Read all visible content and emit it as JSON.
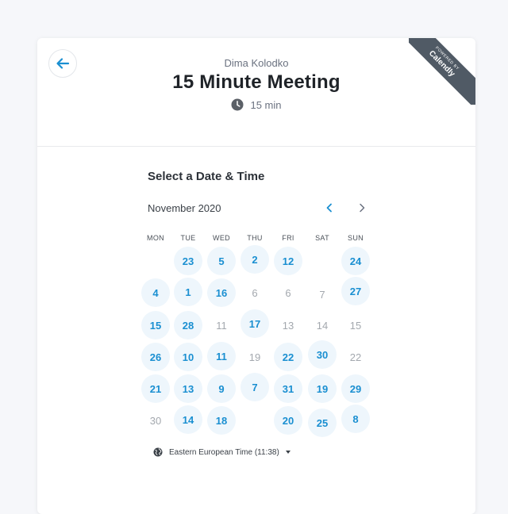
{
  "host": "Dima Kolodko",
  "title": "15 Minute Meeting",
  "duration": "15 min",
  "badge": {
    "small": "Powered by",
    "brand": "Calendly"
  },
  "section_title": "Select a Date & Time",
  "month": "November 2020",
  "weekdays": [
    "MON",
    "TUE",
    "WED",
    "THU",
    "FRI",
    "SAT",
    "SUN"
  ],
  "calendar": {
    "rows": [
      [
        null,
        {
          "label": "23",
          "available": true
        },
        {
          "label": "5",
          "available": true
        },
        {
          "label": "2",
          "available": true
        },
        {
          "label": "12",
          "available": true
        },
        null,
        {
          "label": "24",
          "available": true
        }
      ],
      [
        {
          "label": "4",
          "available": true
        },
        {
          "label": "1",
          "available": true
        },
        {
          "label": "16",
          "available": true
        },
        {
          "label": "6",
          "available": false
        },
        {
          "label": "6",
          "available": false
        },
        {
          "label": "7",
          "available": false
        },
        {
          "label": "27",
          "available": true
        }
      ],
      [
        {
          "label": "15",
          "available": true
        },
        {
          "label": "28",
          "available": true
        },
        {
          "label": "11",
          "available": false
        },
        {
          "label": "17",
          "available": true
        },
        {
          "label": "13",
          "available": false
        },
        {
          "label": "14",
          "available": false
        },
        {
          "label": "15",
          "available": false
        }
      ],
      [
        {
          "label": "26",
          "available": true
        },
        {
          "label": "10",
          "available": true
        },
        {
          "label": "11",
          "available": true
        },
        {
          "label": "19",
          "available": false
        },
        {
          "label": "22",
          "available": true
        },
        {
          "label": "30",
          "available": true
        },
        {
          "label": "22",
          "available": false
        }
      ],
      [
        {
          "label": "21",
          "available": true
        },
        {
          "label": "13",
          "available": true
        },
        {
          "label": "9",
          "available": true
        },
        {
          "label": "7",
          "available": true
        },
        {
          "label": "31",
          "available": true
        },
        {
          "label": "19",
          "available": true
        },
        {
          "label": "29",
          "available": true
        }
      ],
      [
        {
          "label": "30",
          "available": false
        },
        {
          "label": "14",
          "available": true
        },
        {
          "label": "18",
          "available": true
        },
        null,
        {
          "label": "20",
          "available": true
        },
        {
          "label": "25",
          "available": true
        },
        {
          "label": "8",
          "available": true
        }
      ]
    ]
  },
  "timezone": "Eastern European Time (11:38)",
  "colors": {
    "accent": "#1a8fd1",
    "available_bg": "#eef6fc",
    "unavailable_text": "#a3a8ae",
    "badge_bg": "#505a65"
  }
}
